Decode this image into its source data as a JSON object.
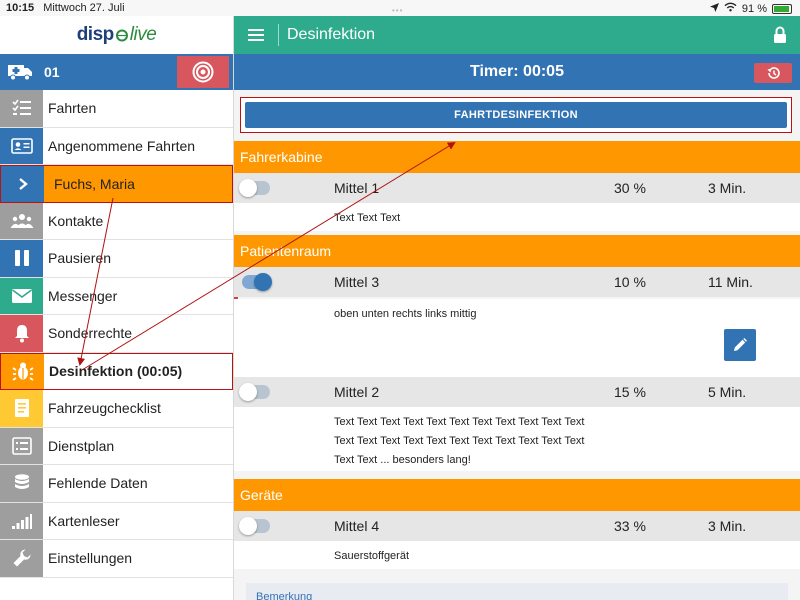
{
  "status_bar": {
    "time": "10:15",
    "date": "Mittwoch 27. Juli",
    "battery": "91 %"
  },
  "sidebar": {
    "logo_part1": "disp",
    "logo_part2": "live",
    "vehicle_number": "01",
    "items": [
      {
        "label": "Fahrten",
        "icon": "checklist-icon",
        "color": "#9e9e9e"
      },
      {
        "label": "Angenommene Fahrten",
        "icon": "id-card-icon",
        "color": "#3273b4"
      },
      {
        "label": "Fuchs, Maria",
        "icon": "chevron-right-icon",
        "color": "#3273b4"
      },
      {
        "label": "Kontakte",
        "icon": "people-icon",
        "color": "#9e9e9e"
      },
      {
        "label": "Pausieren",
        "icon": "pause-icon",
        "color": "#3273b4"
      },
      {
        "label": "Messenger",
        "icon": "mail-icon",
        "color": "#2eaa8c"
      },
      {
        "label": "Sonderrechte",
        "icon": "bell-icon",
        "color": "#d8575e"
      },
      {
        "label": "Desinfektion",
        "label_timer": "(00:05)",
        "icon": "bug-icon",
        "color": "#ff9800"
      },
      {
        "label": "Fahrzeugchecklist",
        "icon": "document-icon",
        "color": "#ffc934"
      },
      {
        "label": "Dienstplan",
        "icon": "list-icon",
        "color": "#9e9e9e"
      },
      {
        "label": "Fehlende Daten",
        "icon": "database-icon",
        "color": "#9e9e9e"
      },
      {
        "label": "Kartenleser",
        "icon": "signal-bars-icon",
        "color": "#9e9e9e"
      },
      {
        "label": "Einstellungen",
        "icon": "wrench-icon",
        "color": "#9e9e9e"
      }
    ]
  },
  "main": {
    "title": "Desinfektion",
    "timer_text": "Timer: 00:05",
    "button_label": "FAHRTDESINFEKTION",
    "sections": [
      {
        "title": "Fahrerkabine",
        "items": [
          {
            "name": "Mittel 1",
            "percent": "30 %",
            "duration": "3 Min.",
            "active": false,
            "desc": [
              "Text Text Text"
            ]
          }
        ]
      },
      {
        "title": "Patientenraum",
        "items": [
          {
            "name": "Mittel 3",
            "percent": "10 %",
            "duration": "11 Min.",
            "active": true,
            "desc": [
              "oben unten rechts links mittig"
            ]
          },
          {
            "name": "Mittel 2",
            "percent": "15 %",
            "duration": "5 Min.",
            "active": false,
            "desc": [
              "Text Text Text Text Text Text Text Text Text Text Text",
              "Text Text Text Text Text Text Text Text Text Text Text",
              "Text Text ... besonders lang!"
            ]
          }
        ]
      },
      {
        "title": "Geräte",
        "items": [
          {
            "name": "Mittel 4",
            "percent": "33 %",
            "duration": "3 Min.",
            "active": false,
            "desc": [
              "Sauerstoffgerät"
            ]
          }
        ]
      }
    ],
    "notes_label": "Bemerkung"
  },
  "colors": {
    "header_teal": "#2eaa8c",
    "primary_blue": "#3273b4",
    "accent_orange": "#ff9800",
    "alert_red": "#d8575e",
    "annotation_red": "#b11111"
  }
}
